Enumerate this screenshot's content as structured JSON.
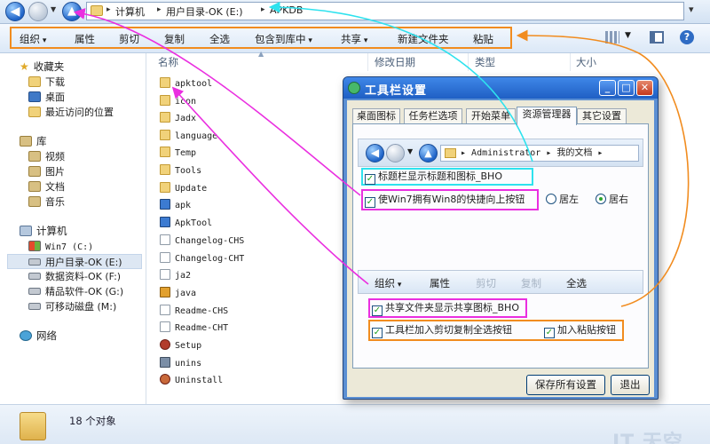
{
  "address": {
    "crumbs": [
      "计算机",
      "用户目录-OK (E:)",
      "APKDB"
    ]
  },
  "toolbar": {
    "items": [
      {
        "label": "组织",
        "dropdown": true
      },
      {
        "label": "属性",
        "dropdown": false
      },
      {
        "label": "剪切",
        "dropdown": false
      },
      {
        "label": "复制",
        "dropdown": false
      },
      {
        "label": "全选",
        "dropdown": false
      },
      {
        "label": "包含到库中",
        "dropdown": true
      },
      {
        "label": "共享",
        "dropdown": true
      },
      {
        "label": "新建文件夹",
        "dropdown": false
      },
      {
        "label": "粘贴",
        "dropdown": false
      }
    ]
  },
  "sidebar": {
    "items": [
      {
        "label": "收藏夹",
        "icon": "star-icon",
        "group": true
      },
      {
        "label": "下载",
        "icon": "downloads-folder-icon"
      },
      {
        "label": "桌面",
        "icon": "desktop-icon"
      },
      {
        "label": "最近访问的位置",
        "icon": "recent-places-icon"
      },
      {
        "label": "库",
        "icon": "library-icon",
        "group": true
      },
      {
        "label": "视频",
        "icon": "videos-icon"
      },
      {
        "label": "图片",
        "icon": "pictures-icon"
      },
      {
        "label": "文档",
        "icon": "documents-icon"
      },
      {
        "label": "音乐",
        "icon": "music-icon"
      },
      {
        "label": "计算机",
        "icon": "computer-icon",
        "group": true
      },
      {
        "label": "Win7 (C:)",
        "icon": "windows-drive-icon"
      },
      {
        "label": "用户目录-OK (E:)",
        "icon": "drive-icon",
        "selected": true
      },
      {
        "label": "数据资料-OK (F:)",
        "icon": "drive-icon"
      },
      {
        "label": "精品软件-OK (G:)",
        "icon": "drive-icon"
      },
      {
        "label": "可移动磁盘 (M:)",
        "icon": "removable-drive-icon"
      },
      {
        "label": "网络",
        "icon": "network-icon",
        "group": true
      }
    ]
  },
  "filelist": {
    "columns": [
      "名称",
      "修改日期",
      "类型",
      "大小"
    ],
    "files": [
      {
        "name": "apktool",
        "icon": "folder-icon"
      },
      {
        "name": "icon",
        "icon": "folder-icon"
      },
      {
        "name": "Jadx",
        "icon": "folder-icon"
      },
      {
        "name": "language",
        "icon": "folder-icon"
      },
      {
        "name": "Temp",
        "icon": "folder-icon"
      },
      {
        "name": "Tools",
        "icon": "folder-icon"
      },
      {
        "name": "Update",
        "icon": "folder-icon"
      },
      {
        "name": "apk",
        "icon": "application-icon"
      },
      {
        "name": "ApkTool",
        "icon": "application-icon"
      },
      {
        "name": "Changelog-CHS",
        "icon": "document-icon"
      },
      {
        "name": "Changelog-CHT",
        "icon": "document-icon"
      },
      {
        "name": "ja2",
        "icon": "document-icon"
      },
      {
        "name": "java",
        "icon": "java-icon"
      },
      {
        "name": "Readme-CHS",
        "icon": "document-icon"
      },
      {
        "name": "Readme-CHT",
        "icon": "document-icon"
      },
      {
        "name": "Setup",
        "icon": "setup-icon"
      },
      {
        "name": "unins",
        "icon": "settings-icon"
      },
      {
        "name": "Uninstall",
        "icon": "uninstall-icon"
      }
    ]
  },
  "status": {
    "count": "18 个对象",
    "watermark": "IT 天空"
  },
  "dialog": {
    "title": "工具栏设置",
    "tabs": [
      "桌面图标",
      "任务栏选项",
      "开始菜单",
      "资源管理器",
      "其它设置"
    ],
    "active_tab": "资源管理器",
    "preview_address": [
      "Administrator",
      "我的文档"
    ],
    "options": {
      "show_title_icon": "标题栏显示标题和图标_BHO",
      "win8_up_button": "使Win7拥有Win8的快捷向上按钮",
      "align_left": "居左",
      "align_right": "居右",
      "share_icon": "共享文件夹显示共享图标_BHO",
      "cut_copy_select": "工具栏加入剪切复制全选按钮",
      "paste_button": "加入粘贴按钮"
    },
    "preview_toolbar": [
      "组织",
      "属性",
      "剪切",
      "复制",
      "全选"
    ],
    "buttons": {
      "save": "保存所有设置",
      "exit": "退出"
    }
  },
  "colors": {
    "highlight_orange": "#f18c1f",
    "highlight_magenta": "#ea2fe0",
    "highlight_cyan": "#2ee2ee"
  }
}
